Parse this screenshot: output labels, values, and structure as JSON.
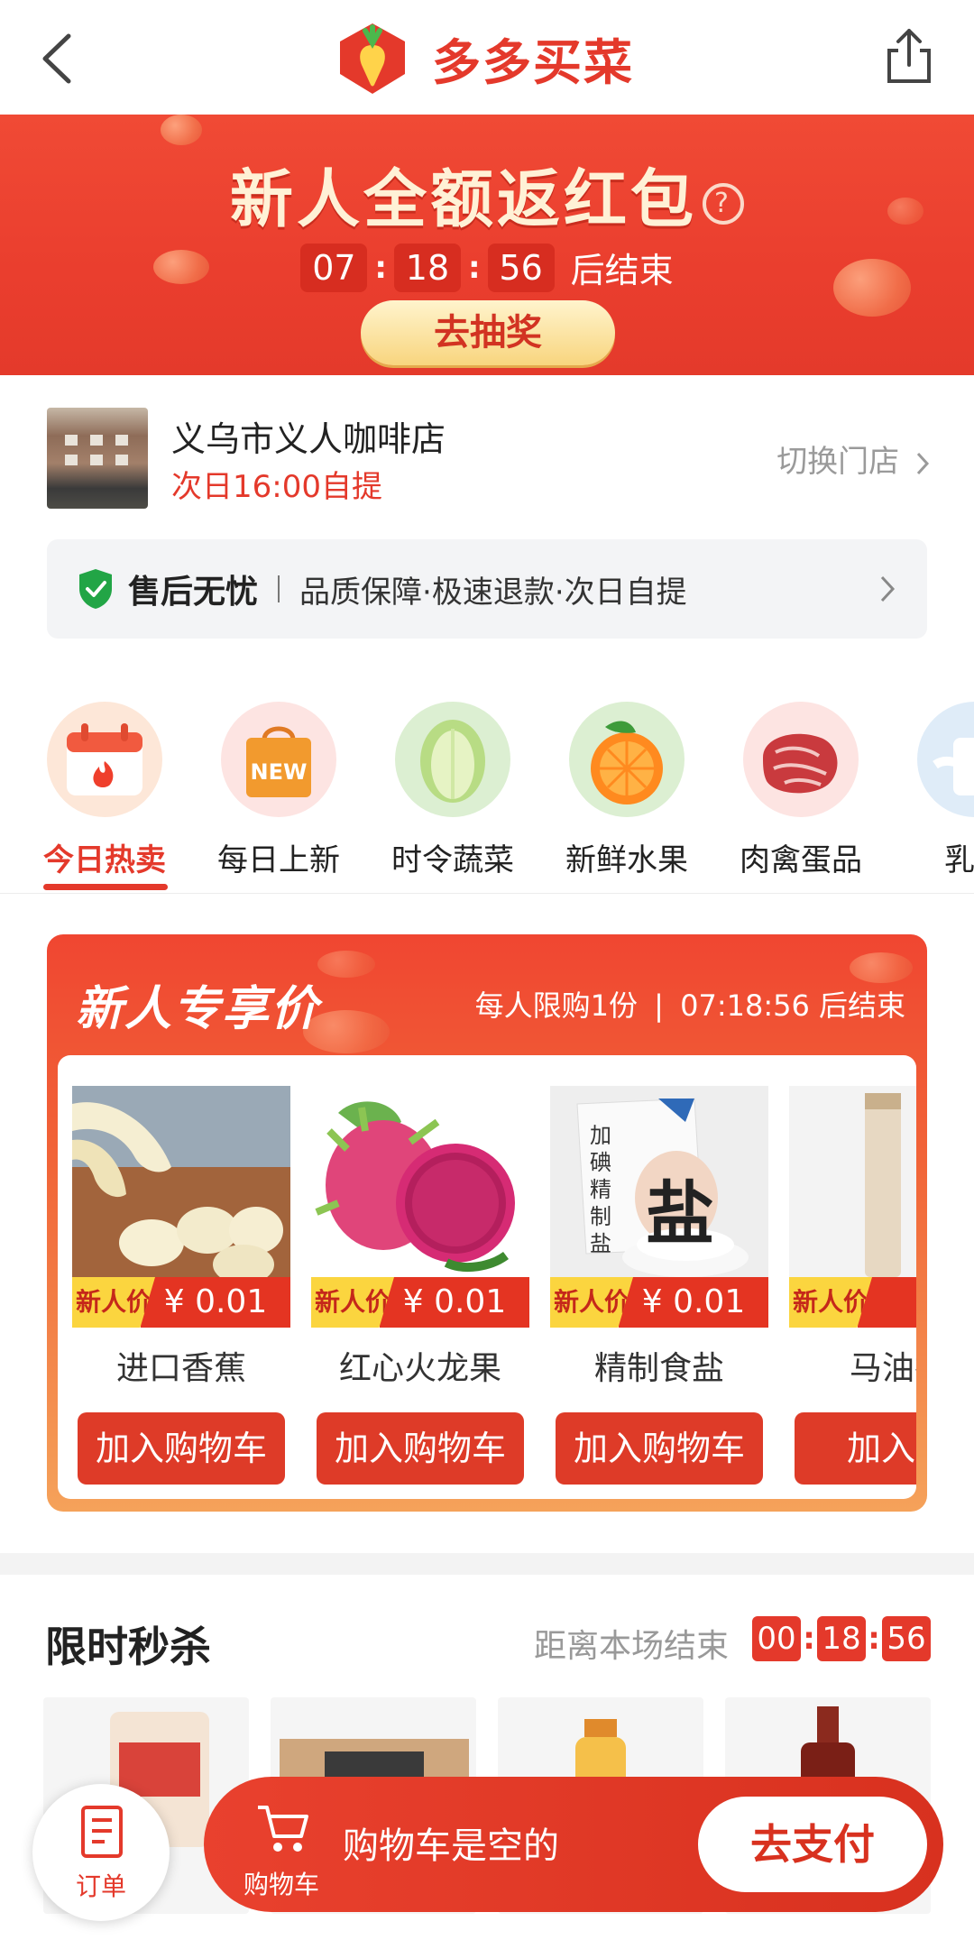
{
  "nav": {
    "brand": "多多买菜",
    "back_icon": "chevron-left-icon",
    "share_icon": "share-icon"
  },
  "banner": {
    "title": "新人全额返红包",
    "help_icon": "?",
    "countdown": {
      "h": "07",
      "m": "18",
      "s": "56",
      "suffix": "后结束"
    },
    "cta": "去抽奖"
  },
  "store": {
    "name": "义乌市义人咖啡店",
    "pickup": "次日16:00自提",
    "switch": "切换门店"
  },
  "guarantee": {
    "title": "售后无忧",
    "desc": "品质保障·极速退款·次日自提"
  },
  "categories": [
    {
      "label": "今日热卖",
      "icon": "calendar-fire-icon",
      "active": true
    },
    {
      "label": "每日上新",
      "icon": "new-bag-icon",
      "badge": "NEW"
    },
    {
      "label": "时令蔬菜",
      "icon": "cabbage-icon"
    },
    {
      "label": "新鲜水果",
      "icon": "orange-icon"
    },
    {
      "label": "肉禽蛋品",
      "icon": "meat-icon"
    },
    {
      "label": "乳品",
      "icon": "milk-icon"
    }
  ],
  "new_user": {
    "title": "新人专享价",
    "limit": "每人限购1份",
    "sep": "|",
    "countdown": "07:18:56",
    "end_suffix": "后结束",
    "products": [
      {
        "name": "进口香蕉",
        "tag": "新人价",
        "price": "¥ 0.01",
        "button": "加入购物车"
      },
      {
        "name": "红心火龙果",
        "tag": "新人价",
        "price": "¥ 0.01",
        "button": "加入购物车"
      },
      {
        "name": "精制食盐",
        "tag": "新人价",
        "price": "¥ 0.01",
        "button": "加入购物车",
        "package_text": "加碘精制盐",
        "package_big": "盐"
      },
      {
        "name": "马油护",
        "tag": "新人价",
        "price": "",
        "button": "加入购"
      }
    ]
  },
  "flash_sale": {
    "title": "限时秒杀",
    "end_label": "距离本场结束",
    "countdown": {
      "h": "00",
      "m": "18",
      "s": "56"
    }
  },
  "bottom": {
    "order_label": "订单",
    "cart_label": "购物车",
    "cart_status": "购物车是空的",
    "pay": "去支付"
  },
  "colors": {
    "accent": "#e4392b",
    "yellow": "#fbd53f",
    "gray_text": "#999999"
  }
}
